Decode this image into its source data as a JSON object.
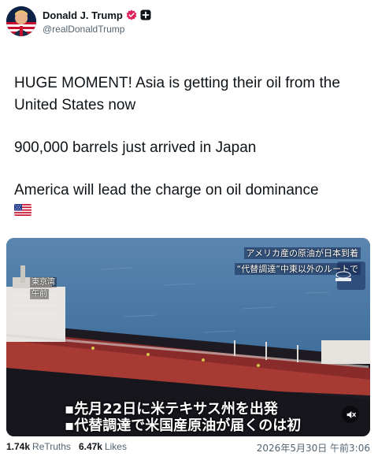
{
  "author": {
    "display_name": "Donald J. Trump",
    "handle": "@realDonaldTrump",
    "avatar_icon": "american-flag-portrait",
    "verified_color": "#e0245e"
  },
  "post": {
    "paragraphs": [
      "HUGE MOMENT! Asia is getting their oil from the United States now",
      "900,000 barrels just arrived in Japan",
      "America will lead the charge on oil dominance"
    ],
    "emoji": "us-flag-icon"
  },
  "media": {
    "headline_line1": "アメリカ産の原油が日本到着",
    "headline_line2": "“代替調達”中東以外のルートで",
    "location_line1": "東京湾",
    "location_line2": "午前",
    "subtitle_line1": "▪先月22日に米テキサス州を出発",
    "subtitle_line2": "▪代替調達で米国産原油が届くのは初",
    "mute_icon": "muted-speaker-icon"
  },
  "footer": {
    "retruths_count": "1.74k",
    "retruths_label": "ReTruths",
    "likes_count": "6.47k",
    "likes_label": "Likes",
    "timestamp": "2026年5月30日 午前3:06"
  }
}
